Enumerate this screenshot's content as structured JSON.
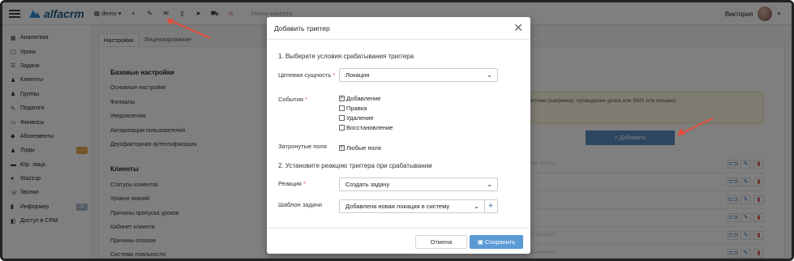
{
  "topbar": {
    "logo_text": "alfacrm",
    "branch_label": "demo",
    "search_placeholder": "Поиск клиента",
    "user_name": "Виктория",
    "icons": [
      "plus-icon",
      "wrench-icon",
      "mail-icon",
      "phone-icon",
      "telegram-icon",
      "cart-icon",
      "bell-icon"
    ]
  },
  "sidebar": {
    "items": [
      {
        "icon": "▦",
        "label": "Аналитика"
      },
      {
        "icon": "▢",
        "label": "Уроки"
      },
      {
        "icon": "☰",
        "label": "Задачи"
      },
      {
        "icon": "♟",
        "label": "Клиенты"
      },
      {
        "icon": "♟",
        "label": "Группы"
      },
      {
        "icon": "✎",
        "label": "Педагоги"
      },
      {
        "icon": "▭",
        "label": "Финансы"
      },
      {
        "icon": "◆",
        "label": "Абонементы"
      },
      {
        "icon": "♟",
        "label": "Лиды",
        "badge": "..."
      },
      {
        "icon": "▬",
        "label": "Юр. лица"
      },
      {
        "icon": "●",
        "label": "Wazzup"
      },
      {
        "icon": "☏",
        "label": "Звонки"
      },
      {
        "icon": "▮",
        "label": "Информер",
        "badge": "31"
      },
      {
        "icon": "◧",
        "label": "Доступ в CRM"
      }
    ],
    "badge_colors": {
      "lead": "#e8a84c",
      "inform": "#a8b8c8"
    }
  },
  "main": {
    "tabs": [
      "Настройки",
      "Лицензирование"
    ],
    "base_header": "Базовые настройки",
    "base_links": [
      "Основные настройки",
      "Филиалы",
      "Уведомления",
      "Авторизация пользователей",
      "Двухфакторная аутентификация"
    ],
    "clients_header": "Клиенты",
    "clients_links": [
      "Статусы клиентов",
      "Уровни знаний",
      "Причины пропуска уроков",
      "Кабинет клиента",
      "Причины отказов",
      "Система лояльности"
    ],
    "info_text": "системе (например, проведение урока или SMS или письмо).",
    "add_button": "+ Добавить",
    "row_hints": [
      "ой (пок тригге)",
      "",
      "",
      "",
      "(SMS-клиенту)",
      "(SMS-клиенту)"
    ]
  },
  "modal": {
    "title": "Добавить триггер",
    "step1": "1. Выберите условия срабатывания триггера",
    "entity_label": "Целевая сущность",
    "entity_value": "Локация",
    "events_label": "События",
    "events": [
      {
        "label": "Добавление",
        "checked": true
      },
      {
        "label": "Правка",
        "checked": false
      },
      {
        "label": "Удаление",
        "checked": false
      },
      {
        "label": "Восстановление",
        "checked": false
      }
    ],
    "fields_label": "Затронутые поля",
    "fields_value": "Любые поля",
    "step2": "2. Установите реакцию триггера при срабатывании",
    "reaction_label": "Реакция",
    "reaction_value": "Создать задачу",
    "template_label": "Шаблон задачи",
    "template_value": "Добавлена новая локация в систему",
    "cancel_label": "Отмена",
    "save_label": "Сохранить"
  },
  "colors": {
    "accent": "#5b9ad5",
    "annotation": "#e74c3c",
    "required": "#d9534f"
  }
}
